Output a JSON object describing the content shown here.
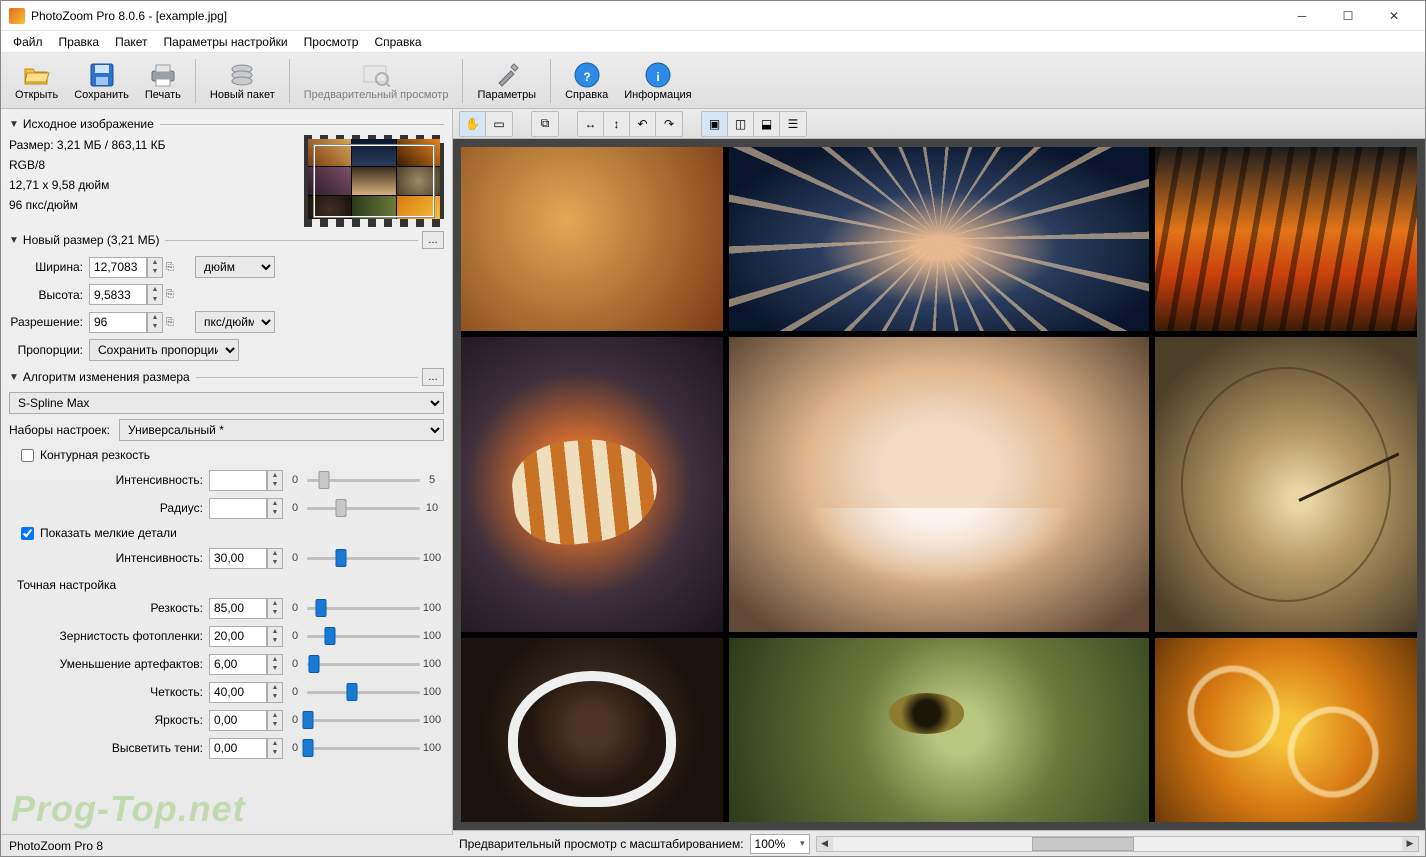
{
  "window": {
    "title": "PhotoZoom Pro 8.0.6 - [example.jpg]"
  },
  "menu": [
    "Файл",
    "Правка",
    "Пакет",
    "Параметры настройки",
    "Просмотр",
    "Справка"
  ],
  "toolbar": [
    {
      "id": "open",
      "label": "Открыть"
    },
    {
      "id": "save",
      "label": "Сохранить"
    },
    {
      "id": "print",
      "label": "Печать"
    },
    {
      "id": "batch",
      "label": "Новый пакет"
    },
    {
      "id": "preview",
      "label": "Предварительный просмотр",
      "disabled": true
    },
    {
      "id": "params",
      "label": "Параметры"
    },
    {
      "id": "help",
      "label": "Справка"
    },
    {
      "id": "info",
      "label": "Информация"
    }
  ],
  "source": {
    "header": "Исходное изображение",
    "size_line": "Размер: 3,21 МБ / 863,11 КБ",
    "mode": "RGB/8",
    "dims": "12,71 x 9,58 дюйм",
    "dpi": "96 пкс/дюйм"
  },
  "newsize": {
    "header": "Новый размер (3,21 МБ)",
    "width_label": "Ширина:",
    "width": "12,7083",
    "height_label": "Высота:",
    "height": "9,5833",
    "res_label": "Разрешение:",
    "res": "96",
    "unit": "дюйм",
    "res_unit": "пкс/дюйм",
    "ratio_label": "Пропорции:",
    "ratio": "Сохранить пропорции"
  },
  "resize": {
    "header": "Алгоритм изменения размера",
    "method": "S-Spline Max",
    "presets_label": "Наборы настроек:",
    "preset": "Универсальный *",
    "unsharp_cb": "Контурная резкость",
    "intensity_label": "Интенсивность:",
    "intensity": "",
    "int_min": "0",
    "int_max": "5",
    "radius_label": "Радиус:",
    "radius": "",
    "rad_min": "0",
    "rad_max": "10",
    "fine_cb": "Показать мелкие детали",
    "fine_intensity": "30,00",
    "min0": "0",
    "max100": "100",
    "finetune_header": "Точная настройка",
    "sharp_label": "Резкость:",
    "sharp": "85,00",
    "grain_label": "Зернистость фотопленки:",
    "grain": "20,00",
    "artifact_label": "Уменьшение артефактов:",
    "artifact": "6,00",
    "crisp_label": "Четкость:",
    "crisp": "40,00",
    "bright_label": "Яркость:",
    "bright": "0,00",
    "shadow_label": "Высветить тени:",
    "shadow": "0,00"
  },
  "status": {
    "product": "PhotoZoom Pro 8"
  },
  "preview_bar": {
    "label": "Предварительный просмотр с масштабированием:",
    "zoom": "100%"
  }
}
